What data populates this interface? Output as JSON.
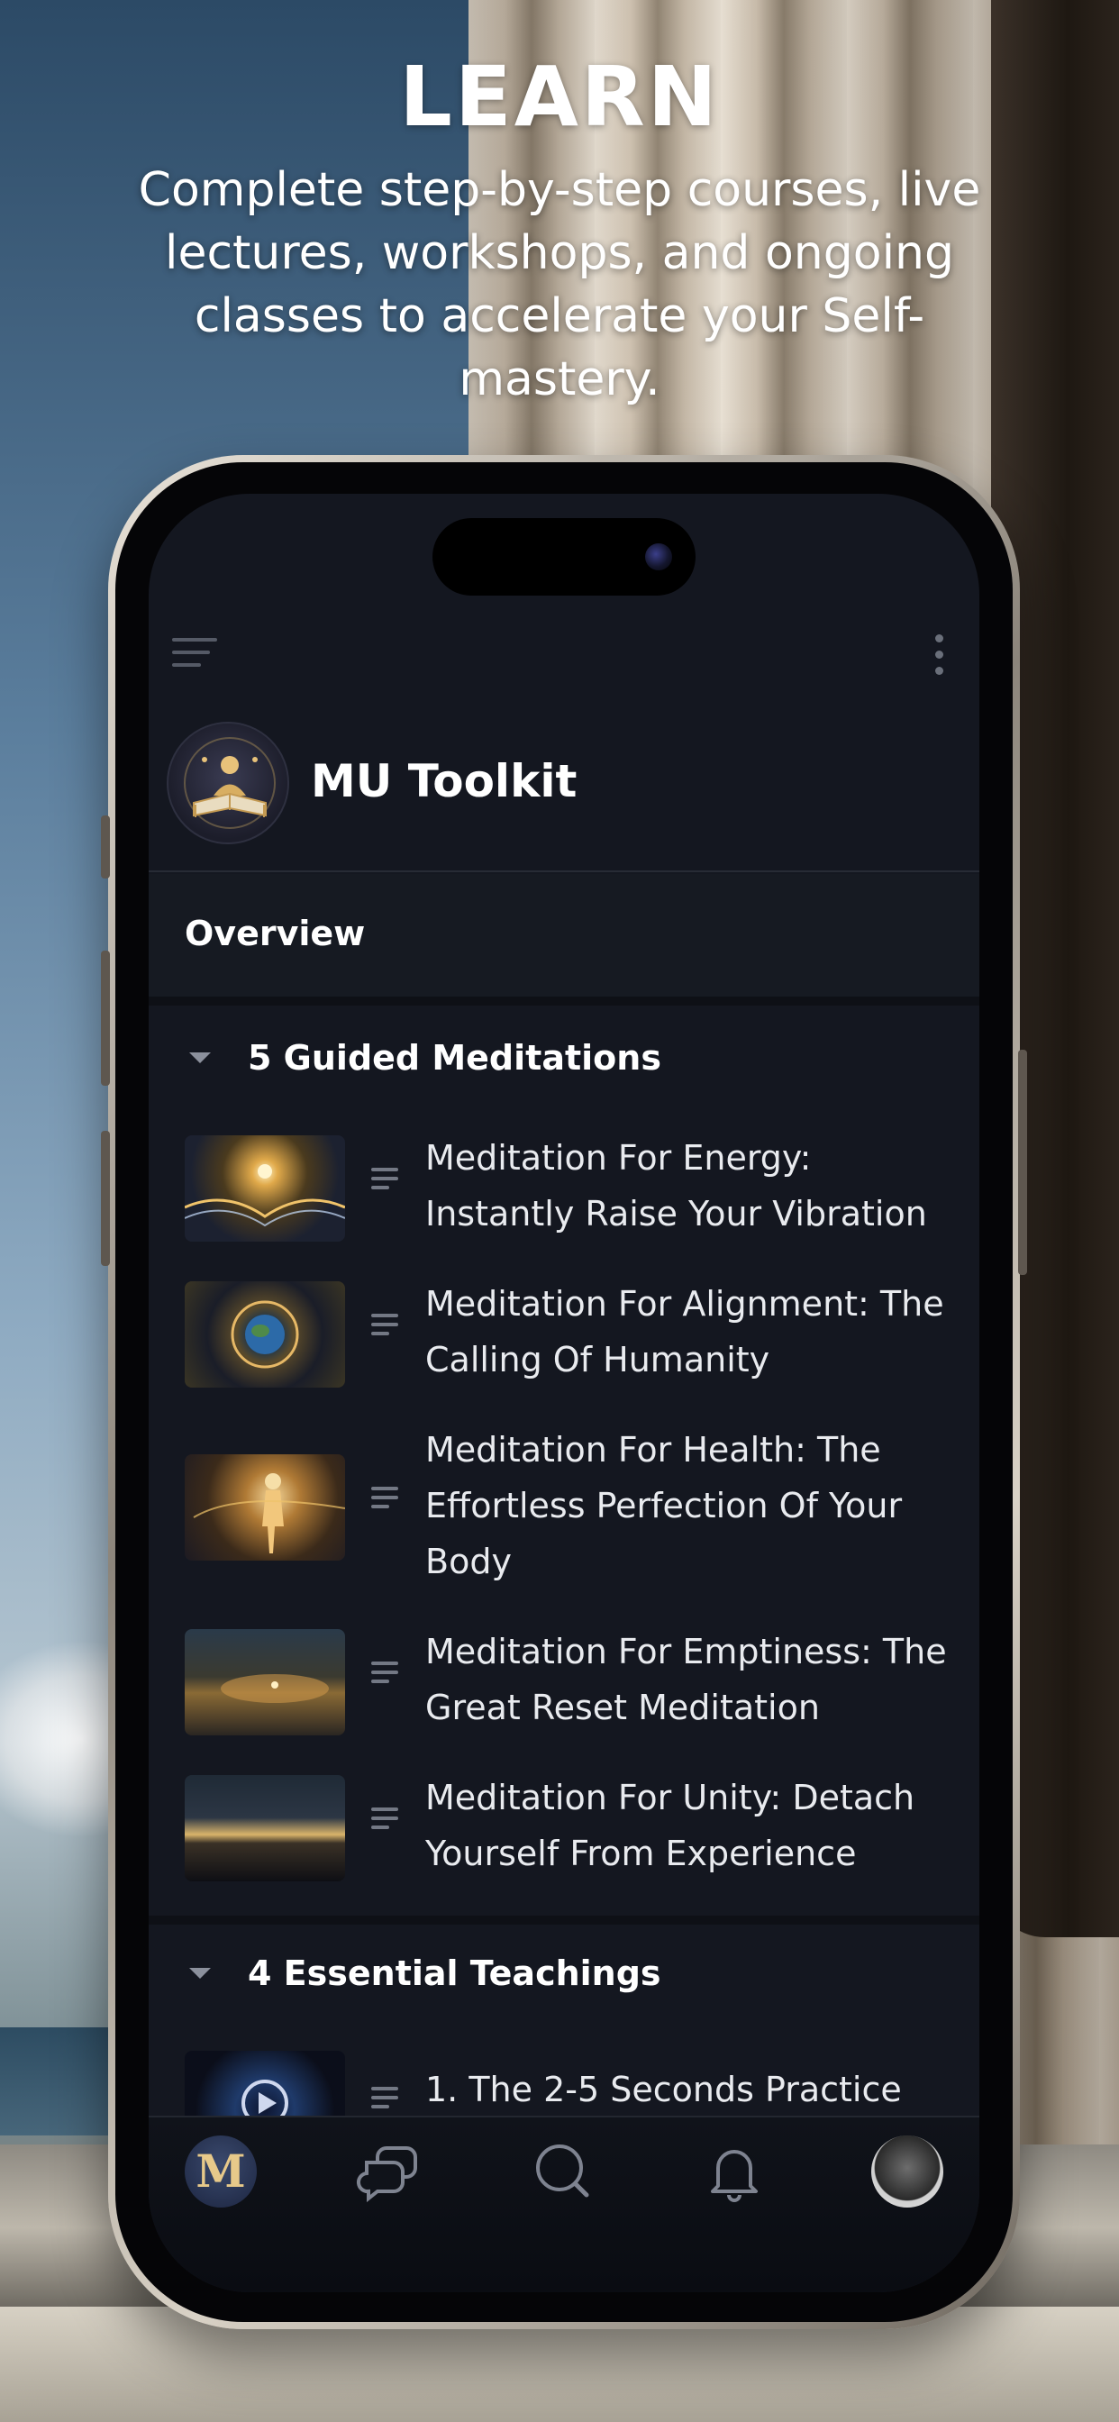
{
  "marketing": {
    "headline": "LEARN",
    "subheadline": "Complete step-by-step courses, live lectures, workshops, and ongoing classes to accelerate your Self-mastery."
  },
  "app": {
    "course_title": "MU Toolkit",
    "overview_label": "Overview",
    "sections": [
      {
        "title": "5 Guided Meditations",
        "lessons": [
          {
            "title": "Meditation For Energy: Instantly Raise Your Vibration"
          },
          {
            "title": "Meditation For Alignment: The Calling Of Humanity"
          },
          {
            "title": "Meditation For Health: The Effortless Perfection Of Your Body"
          },
          {
            "title": "Meditation For Emptiness: The Great Reset Meditation"
          },
          {
            "title": "Meditation For Unity: Detach Yourself From Experience"
          }
        ]
      },
      {
        "title": "4 Essential Teachings",
        "lessons": [
          {
            "title": "1. The 2-5 Seconds Practice"
          }
        ]
      }
    ],
    "tabbar": {
      "home_badge_letter": "M",
      "tabs": [
        "home-icon",
        "messages-icon",
        "search-icon",
        "bell-icon",
        "profile-avatar"
      ]
    },
    "colors": {
      "screen_bg": "#141720",
      "text_primary": "#ffffff",
      "accent_gold": "#e7c98a"
    }
  }
}
